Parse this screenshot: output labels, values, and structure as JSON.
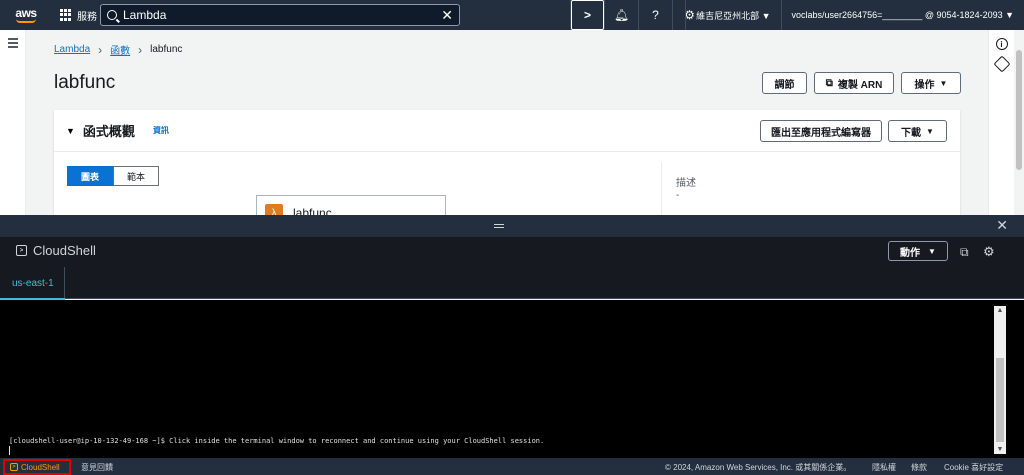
{
  "topbar": {
    "logo": "aws",
    "services_label": "服務",
    "search_value": "Lambda",
    "region": "維吉尼亞州北部 ▼",
    "account": "voclabs/user2664756=________ @ 9054-1824-2093 ▼",
    "icons": [
      "cloudshell-icon",
      "bell-icon",
      "help-icon",
      "gear-icon"
    ]
  },
  "breadcrumb": {
    "item1": "Lambda",
    "item2": "函數",
    "current": "labfunc"
  },
  "page_title": "labfunc",
  "header_buttons": {
    "throttle": "調節",
    "copy_arn": "複製 ARN",
    "actions": "操作"
  },
  "overview": {
    "title": "函式概觀",
    "info": "資訊",
    "export_button": "匯出至應用程式編寫器",
    "download_button": "下載",
    "tab_diagram": "圖表",
    "tab_template": "範本",
    "function_name": "labfunc",
    "description_label": "描述",
    "description_value": "-"
  },
  "cloudshell": {
    "title": "CloudShell",
    "actions_label": "動作",
    "tab_label": "us-east-1",
    "terminal_line": "[cloudshell-user@ip-10-132-49-168 ~]$ Click inside the terminal window to reconnect and continue using your CloudShell session."
  },
  "footer": {
    "cloudshell": "CloudShell",
    "feedback": "意見回饋",
    "copyright": "© 2024, Amazon Web Services, Inc. 或其關係企業。",
    "privacy": "隱私權",
    "terms": "條款",
    "cookie": "Cookie 喜好設定"
  },
  "colors": {
    "topbar": "#232f3e",
    "primary": "#0972d3",
    "accent": "#ff9900",
    "highlight": "#e10000"
  }
}
